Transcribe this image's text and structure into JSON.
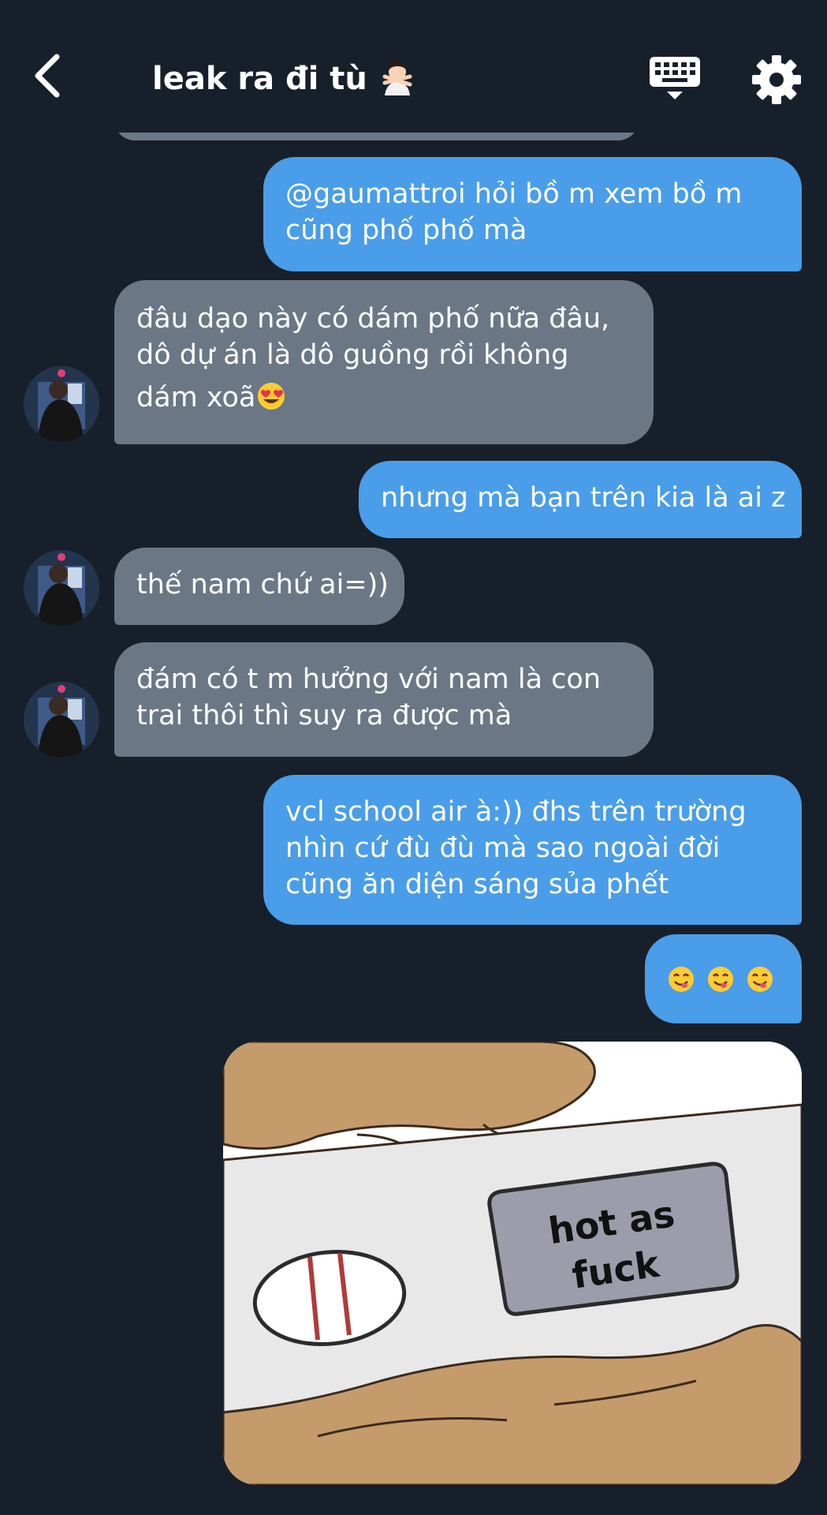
{
  "header": {
    "title": "leak ra đi tù",
    "title_emoji": "woman-gesturing-no-emoji"
  },
  "icons": {
    "back": "chevron-left-icon",
    "keyboard": "keyboard-icon",
    "settings": "gear-icon"
  },
  "colors": {
    "background": "#17202a",
    "outgoing_bubble": "#4a9de8",
    "incoming_bubble": "#6b7785",
    "text": "#ffffff"
  },
  "messages": [
    {
      "direction": "out",
      "lines": [
        "@gaumattroi hỏi bồ m xem bồ m",
        "cũng phố phố mà"
      ]
    },
    {
      "direction": "in",
      "lines": [
        "đâu dạo này có dám phố nữa đâu,",
        "dô dự án là dô guồng rồi không",
        "dám xoã"
      ],
      "trailing_emoji": "heart-eyes-emoji"
    },
    {
      "direction": "out",
      "lines": [
        "nhưng mà bạn trên kia là ai z"
      ]
    },
    {
      "direction": "in",
      "lines": [
        "thế nam chứ ai=))"
      ]
    },
    {
      "direction": "in",
      "lines": [
        "đám có t m hưởng với nam là con",
        "trai thôi thì suy ra được mà"
      ]
    },
    {
      "direction": "out",
      "lines": [
        "vcl school air à:)) đhs trên trường",
        "nhìn cứ đù đù mà sao ngoài đời",
        "cũng ăn diện sáng sủa phết"
      ]
    },
    {
      "direction": "out",
      "emojis": [
        "yum-emoji",
        "yum-emoji",
        "yum-emoji"
      ]
    }
  ],
  "image_message": {
    "caption_line1": "hot as",
    "caption_line2": "fuck"
  }
}
